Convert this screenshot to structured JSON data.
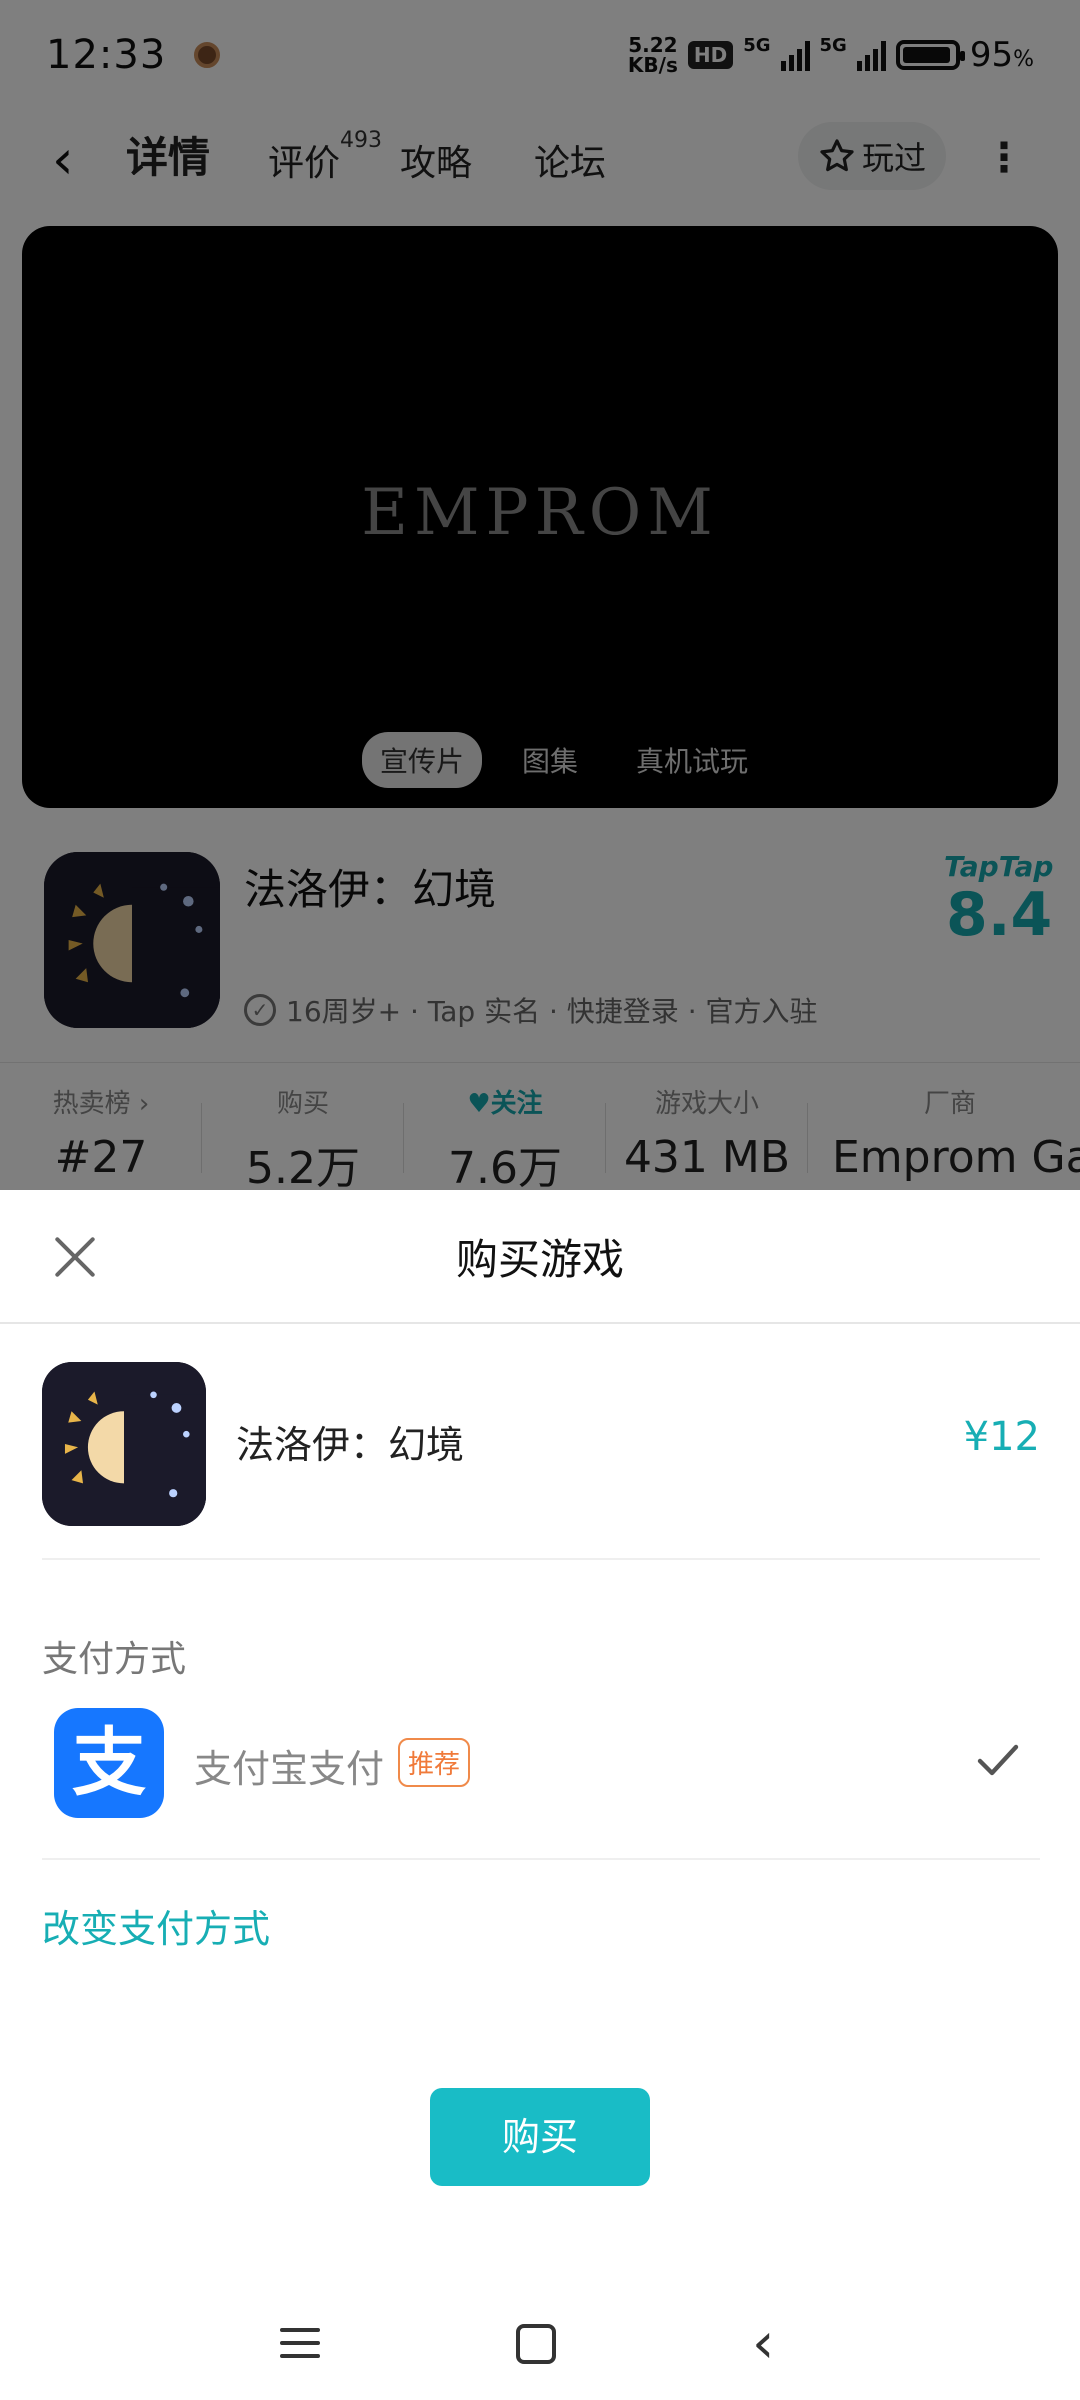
{
  "status_bar": {
    "time": "12:33",
    "net_speed_value": "5.22",
    "net_speed_unit": "KB/s",
    "hd_label": "HD",
    "sig1_label": "5G",
    "sig2_label": "5G",
    "battery_percent": "95",
    "battery_unit": "%"
  },
  "nav": {
    "tabs": [
      {
        "label": "详情",
        "active": true
      },
      {
        "label": "评价",
        "badge": "493"
      },
      {
        "label": "攻略"
      },
      {
        "label": "论坛"
      }
    ],
    "played_label": "玩过"
  },
  "video": {
    "logo_text": "EMPROM",
    "tabs": [
      "宣传片",
      "图集",
      "真机试玩"
    ]
  },
  "game": {
    "title": "法洛伊：幻境",
    "score_brand": "TapTap",
    "score": "8.4",
    "tags": "16周岁+ · Tap 实名 · 快捷登录 · 官方入驻"
  },
  "stats": [
    {
      "label": "热卖榜 ›",
      "value": "#27"
    },
    {
      "label": "购买",
      "value": "5.2万"
    },
    {
      "label": "关注",
      "value": "7.6万"
    },
    {
      "label": "游戏大小",
      "value": "431 MB"
    },
    {
      "label": "厂商",
      "value": "Emprom Ga"
    }
  ],
  "sheet": {
    "title": "购买游戏",
    "product_name": "法洛伊：幻境",
    "price": "¥12",
    "pay_heading": "支付方式",
    "alipay_glyph": "支",
    "pay_method": "支付宝支付",
    "recommend_badge": "推荐",
    "change_pay": "改变支付方式",
    "buy_button": "购买"
  },
  "colors": {
    "accent": "#19bcc6",
    "price": "#17aeb4",
    "alipay": "#1677ff",
    "recommend": "#f07a3a"
  }
}
